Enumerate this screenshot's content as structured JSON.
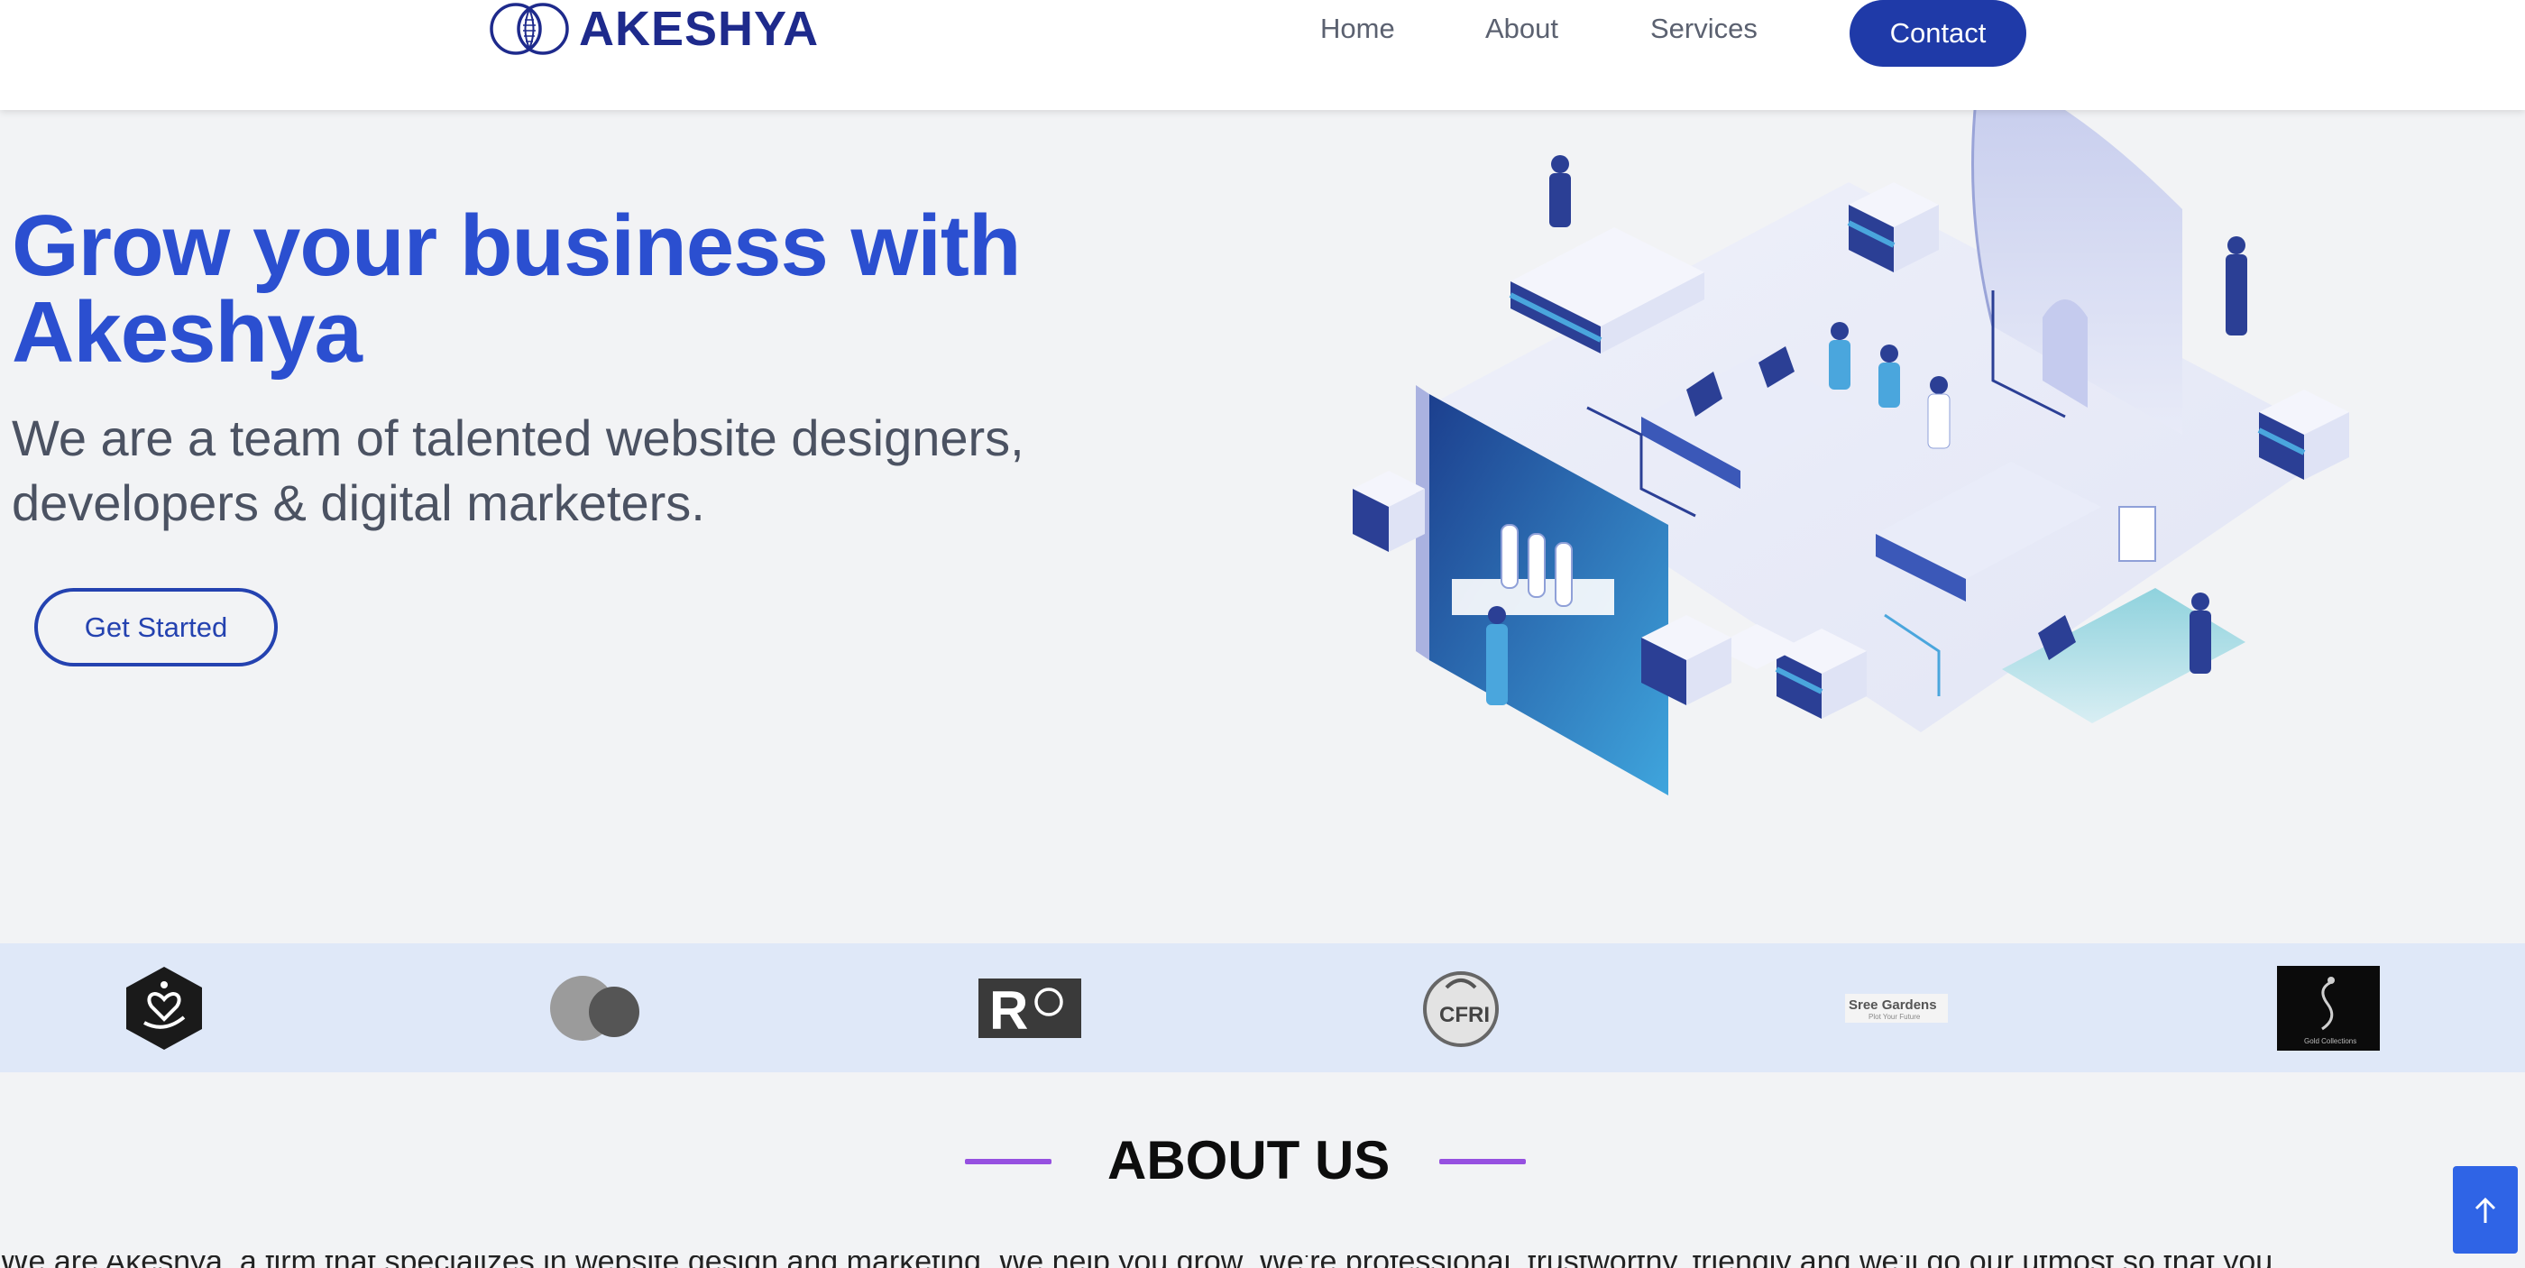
{
  "brand": {
    "name": "AKESHYA",
    "color": "#1e2a8c",
    "icon": "interlocking-rings-logo"
  },
  "nav": {
    "items": [
      {
        "label": "Home"
      },
      {
        "label": "About"
      },
      {
        "label": "Services"
      }
    ],
    "contact_label": "Contact",
    "accent": "#1f3aa8"
  },
  "hero": {
    "title": "Grow your business with Akeshya",
    "subtitle": "We are a team of talented website designers, developers & digital marketers.",
    "cta_label": "Get Started",
    "illustration": "isometric-office-team-illustration"
  },
  "clients": {
    "logos": [
      {
        "name": "heart-hand-hexagon-logo"
      },
      {
        "name": "grey-circles-logo"
      },
      {
        "name": "ro-logo",
        "text": "RO"
      },
      {
        "name": "cfri-logo",
        "text": "CFRI"
      },
      {
        "name": "sree-gardens-logo",
        "text": "Sree Gardens",
        "tagline": "Plot Your Future"
      },
      {
        "name": "gold-collections-logo",
        "text": "Gold Collections"
      }
    ]
  },
  "about": {
    "title": "ABOUT US",
    "peek_text": "We are Akeshya, a firm that specializes in website design and marketing. We help you grow. We're professional, trustworthy, friendly and we'll do our utmost so that you"
  },
  "scroll_top": {
    "icon": "arrow-up-icon"
  }
}
